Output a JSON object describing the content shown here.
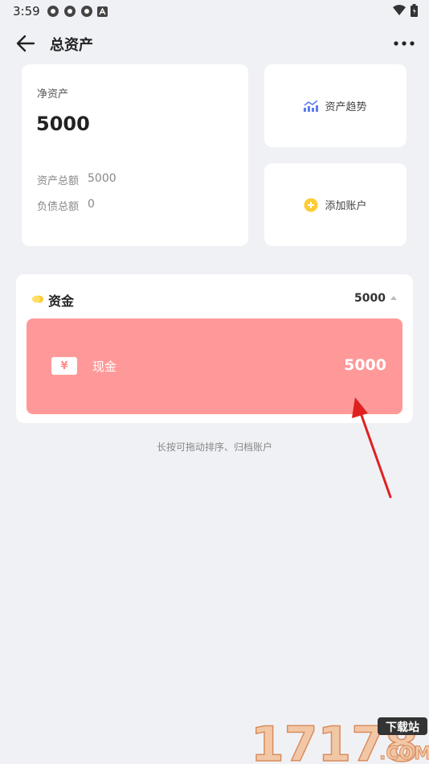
{
  "status": {
    "time": "3:59"
  },
  "header": {
    "title": "总资产"
  },
  "net_assets": {
    "label": "净资产",
    "value": "5000",
    "total_assets_label": "资产总额",
    "total_assets_value": "5000",
    "total_liabilities_label": "负债总额",
    "total_liabilities_value": "0"
  },
  "actions": {
    "trend_label": "资产趋势",
    "add_account_label": "添加账户"
  },
  "fund_group": {
    "title": "资金",
    "total": "5000",
    "accounts": [
      {
        "icon": "¥",
        "name": "现金",
        "balance": "5000",
        "color": "#ff9999"
      }
    ]
  },
  "hint": "长按可拖动排序、归档账户",
  "watermark": {
    "number": "17178",
    "badge": "下载站",
    "domain": ".COM"
  },
  "colors": {
    "accent_yellow": "#ffcc33",
    "trend_blue": "#5b7cf0",
    "cash_red": "#ff9999",
    "annotation_arrow": "#e02020"
  }
}
